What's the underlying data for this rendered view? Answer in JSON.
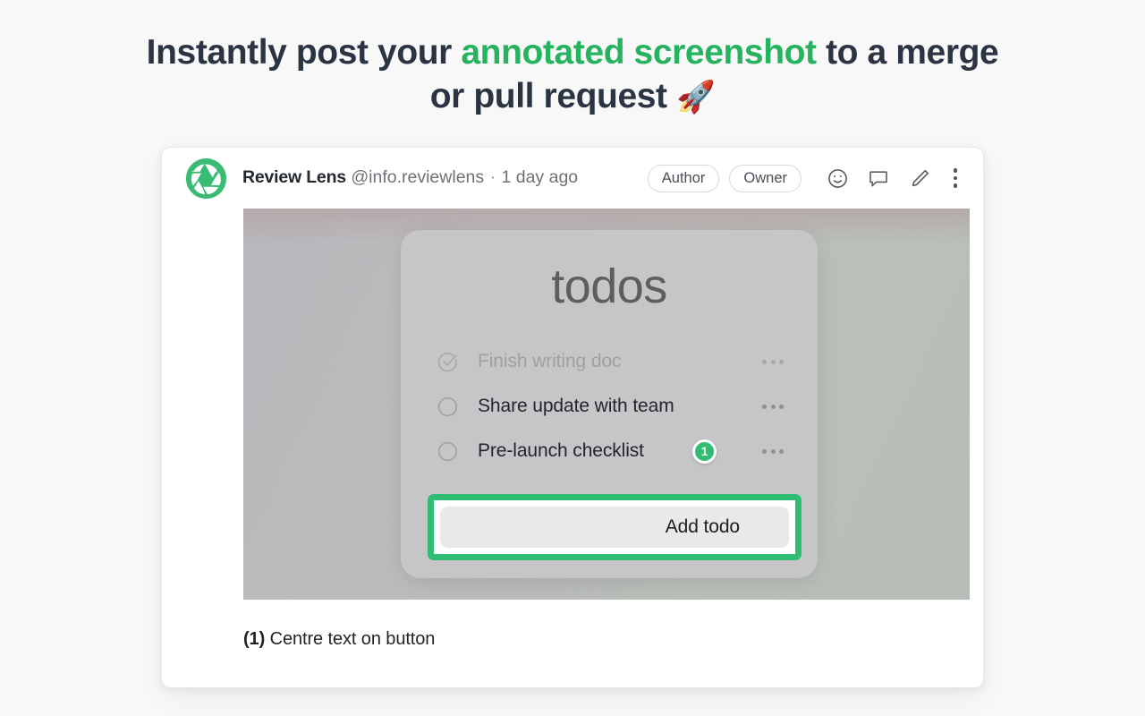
{
  "headline": {
    "part1": "Instantly post your ",
    "accent": "annotated screenshot",
    "part2": " to a merge or pull request ",
    "emoji": "🚀"
  },
  "colors": {
    "accent_green": "#2ebd72",
    "headline_green": "#26b35f",
    "headline_text": "#2b3442",
    "page_background": "#f8f8f8",
    "card_background": "#ffffff",
    "todo_panel": "#c6c6c8"
  },
  "post": {
    "avatar_icon": "aperture-icon",
    "author_name": "Review Lens",
    "handle": "@info.reviewlens",
    "separator": "·",
    "timestamp": "1 day ago",
    "badges": [
      {
        "label": "Author",
        "name": "author-badge"
      },
      {
        "label": "Owner",
        "name": "owner-badge"
      }
    ],
    "actions": [
      {
        "icon": "emoji-reaction-icon",
        "label": "Add reaction"
      },
      {
        "icon": "comment-icon",
        "label": "Comment"
      },
      {
        "icon": "pencil-edit-icon",
        "label": "Edit"
      },
      {
        "icon": "kebab-menu-icon",
        "label": "More options"
      }
    ]
  },
  "screenshot": {
    "app_title": "todos",
    "todos": [
      {
        "text": "Finish writing doc",
        "done": true,
        "marker": null
      },
      {
        "text": "Share update with team",
        "done": false,
        "marker": null
      },
      {
        "text": "Pre-launch checklist",
        "done": false,
        "marker": "1"
      }
    ],
    "add_button_label": "Add todo",
    "row_menu_icon": "ellipsis-icon",
    "checkbox_done_icon": "check-circle-icon",
    "checkbox_todo_icon": "empty-circle-icon"
  },
  "caption": {
    "number": "(1)",
    "text": " Centre text on button"
  }
}
